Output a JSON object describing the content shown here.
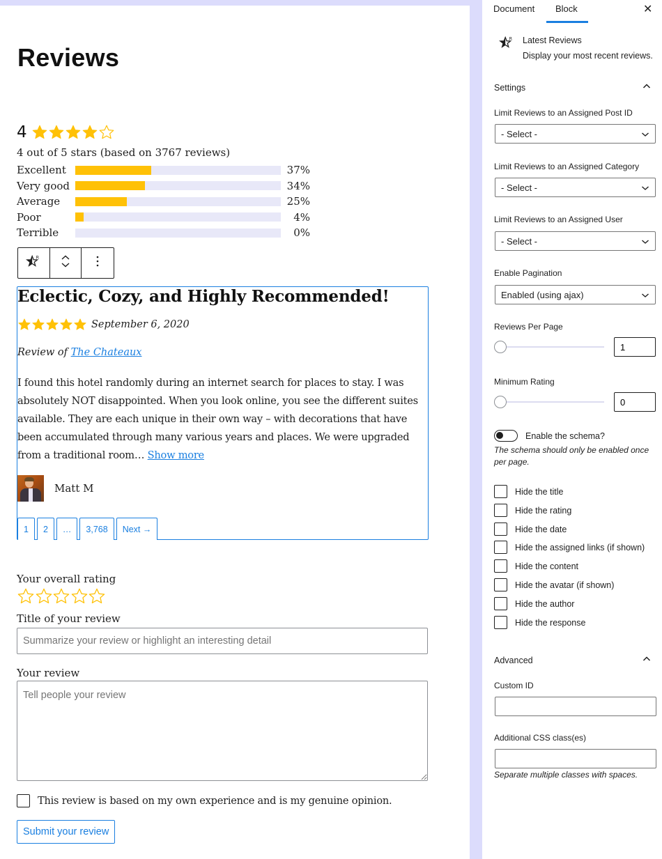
{
  "page": {
    "title": "Reviews"
  },
  "summary": {
    "average": "4",
    "average_rating": 4,
    "max_rating": 5,
    "text": "4 out of 5 stars (based on 3767 reviews)",
    "breakdown": [
      {
        "label": "Excellent",
        "percent_text": "37%",
        "percent": 37
      },
      {
        "label": "Very good",
        "percent_text": "34%",
        "percent": 34
      },
      {
        "label": "Average",
        "percent_text": "25%",
        "percent": 25
      },
      {
        "label": "Poor",
        "percent_text": "4%",
        "percent": 4
      },
      {
        "label": "Terrible",
        "percent_text": "0%",
        "percent": 0
      }
    ]
  },
  "colors": {
    "star": "#ffc107",
    "accent": "#1a7fe0",
    "editor_backdrop": "#dcdcfc"
  },
  "block_toolbar": {
    "icons": [
      "latest-reviews-block-icon",
      "move-up-down-icon",
      "more-options-icon"
    ]
  },
  "review": {
    "title": "Eclectic, Cozy, and Highly Recommended!",
    "rating": 5,
    "date": "September 6, 2020",
    "review_of_prefix": "Review of",
    "review_of_link": "The Chateaux",
    "body": "I found this hotel randomly during an internet search for places to stay. I was absolutely NOT disappointed. When you look online, you see the different suites available. They are each unique in their own way – with decorations that have been accumulated through many various years and places. We were upgraded from a traditional room…",
    "show_more": "Show more",
    "author": "Matt M"
  },
  "pagination": {
    "items": [
      "1",
      "2",
      "…",
      "3,768",
      "Next →"
    ]
  },
  "form": {
    "rating_label": "Your overall rating",
    "rating_value": 0,
    "title_label": "Title of your review",
    "title_placeholder": "Summarize your review or highlight an interesting detail",
    "review_label": "Your review",
    "review_placeholder": "Tell people your review",
    "consent_label": "This review is based on my own experience and is my genuine opinion.",
    "submit_label": "Submit your review"
  },
  "sidebar": {
    "tabs": [
      {
        "label": "Document",
        "active": false
      },
      {
        "label": "Block",
        "active": true
      }
    ],
    "close_icon": "close-icon",
    "block_card": {
      "name": "Latest Reviews",
      "description": "Display your most recent reviews."
    },
    "settings": {
      "heading": "Settings",
      "post_id_label": "Limit Reviews to an Assigned Post ID",
      "post_id_value": "- Select -",
      "category_label": "Limit Reviews to an Assigned Category",
      "category_value": "- Select -",
      "user_label": "Limit Reviews to an Assigned User",
      "user_value": "- Select -",
      "pagination_label": "Enable Pagination",
      "pagination_value": "Enabled (using ajax)",
      "per_page_label": "Reviews Per Page",
      "per_page_value": "1",
      "min_rating_label": "Minimum Rating",
      "min_rating_value": "0",
      "schema_label": "Enable the schema?",
      "schema_enabled": false,
      "schema_help": "The schema should only be enabled once per page.",
      "hide_options": [
        {
          "label": "Hide the title",
          "checked": false
        },
        {
          "label": "Hide the rating",
          "checked": false
        },
        {
          "label": "Hide the date",
          "checked": false
        },
        {
          "label": "Hide the assigned links (if shown)",
          "checked": false
        },
        {
          "label": "Hide the content",
          "checked": false
        },
        {
          "label": "Hide the avatar (if shown)",
          "checked": false
        },
        {
          "label": "Hide the author",
          "checked": false
        },
        {
          "label": "Hide the response",
          "checked": false
        }
      ]
    },
    "advanced": {
      "heading": "Advanced",
      "custom_id_label": "Custom ID",
      "custom_id_value": "",
      "css_class_label": "Additional CSS class(es)",
      "css_class_value": "",
      "css_class_help": "Separate multiple classes with spaces."
    }
  }
}
